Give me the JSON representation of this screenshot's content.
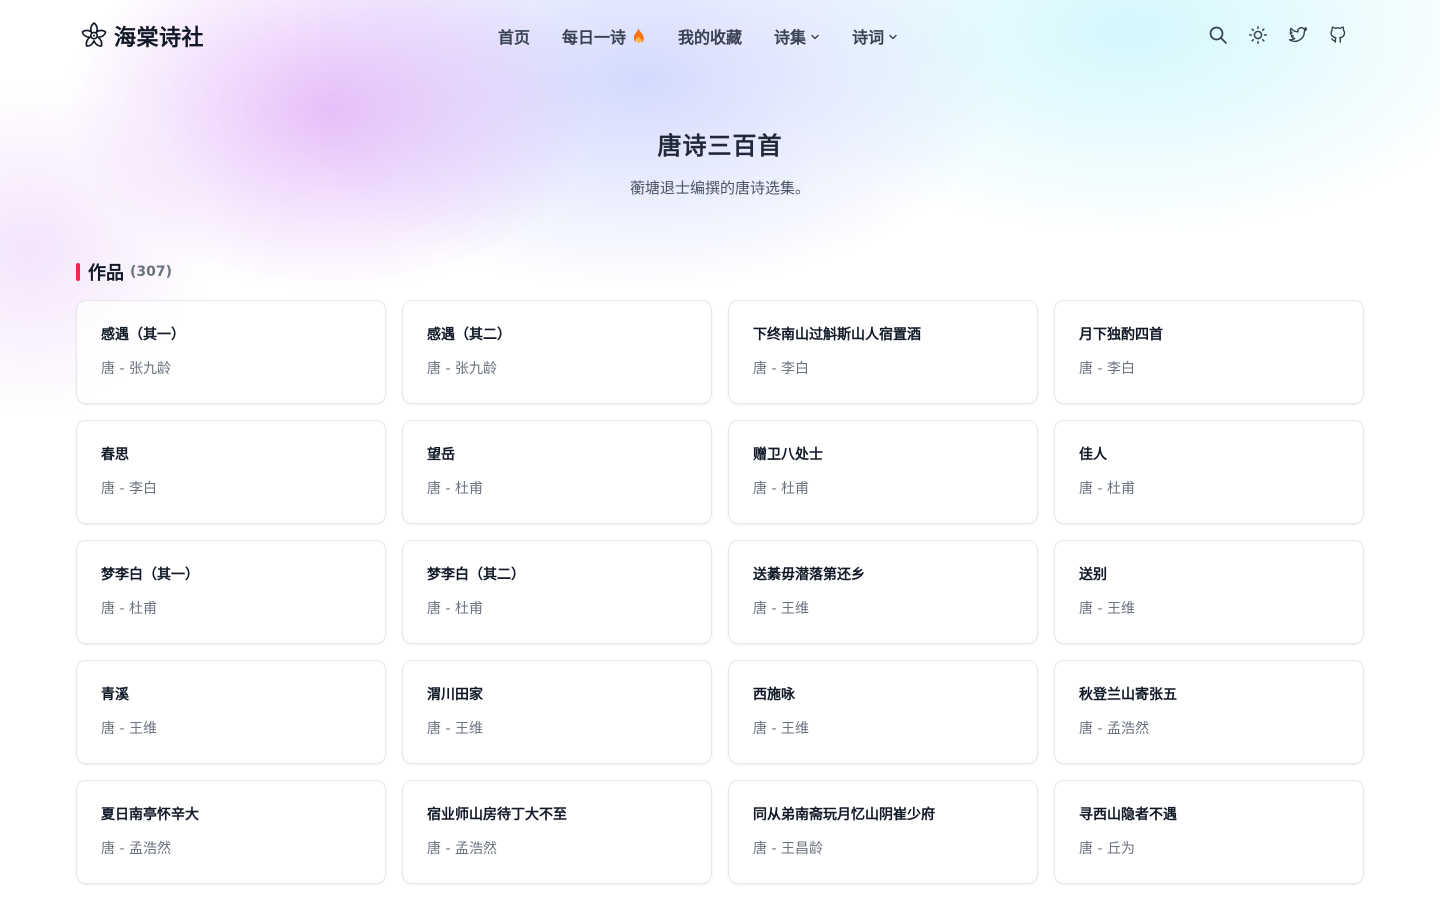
{
  "brand": {
    "logo_icon": "flower-icon",
    "name": "海棠诗社"
  },
  "nav": {
    "items": [
      {
        "label": "首页",
        "icon": ""
      },
      {
        "label": "每日一诗",
        "icon": "flame-icon"
      },
      {
        "label": "我的收藏",
        "icon": ""
      },
      {
        "label": "诗集",
        "icon": "chevron-down-icon"
      },
      {
        "label": "诗词",
        "icon": "chevron-down-icon"
      }
    ]
  },
  "actions": {
    "icons": [
      "search-icon",
      "sun-icon",
      "twitter-icon",
      "github-icon"
    ]
  },
  "hero": {
    "title": "唐诗三百首",
    "subtitle": "蘅塘退士编撰的唐诗选集。"
  },
  "section": {
    "title": "作品",
    "count": "(307)",
    "accent_color": "#f0284f"
  },
  "poems": [
    {
      "title": "感遇（其一）",
      "meta": "唐 - 张九龄"
    },
    {
      "title": "感遇（其二）",
      "meta": "唐 - 张九龄"
    },
    {
      "title": "下终南山过斛斯山人宿置酒",
      "meta": "唐 - 李白"
    },
    {
      "title": "月下独酌四首",
      "meta": "唐 - 李白"
    },
    {
      "title": "春思",
      "meta": "唐 - 李白"
    },
    {
      "title": "望岳",
      "meta": "唐 - 杜甫"
    },
    {
      "title": "赠卫八处士",
      "meta": "唐 - 杜甫"
    },
    {
      "title": "佳人",
      "meta": "唐 - 杜甫"
    },
    {
      "title": "梦李白（其一）",
      "meta": "唐 - 杜甫"
    },
    {
      "title": "梦李白（其二）",
      "meta": "唐 - 杜甫"
    },
    {
      "title": "送綦毋潜落第还乡",
      "meta": "唐 - 王维"
    },
    {
      "title": "送别",
      "meta": "唐 - 王维"
    },
    {
      "title": "青溪",
      "meta": "唐 - 王维"
    },
    {
      "title": "渭川田家",
      "meta": "唐 - 王维"
    },
    {
      "title": "西施咏",
      "meta": "唐 - 王维"
    },
    {
      "title": "秋登兰山寄张五",
      "meta": "唐 - 孟浩然"
    },
    {
      "title": "夏日南亭怀辛大",
      "meta": "唐 - 孟浩然"
    },
    {
      "title": "宿业师山房待丁大不至",
      "meta": "唐 - 孟浩然"
    },
    {
      "title": "同从弟南斋玩月忆山阴崔少府",
      "meta": "唐 - 王昌龄"
    },
    {
      "title": "寻西山隐者不遇",
      "meta": "唐 - 丘为"
    }
  ]
}
